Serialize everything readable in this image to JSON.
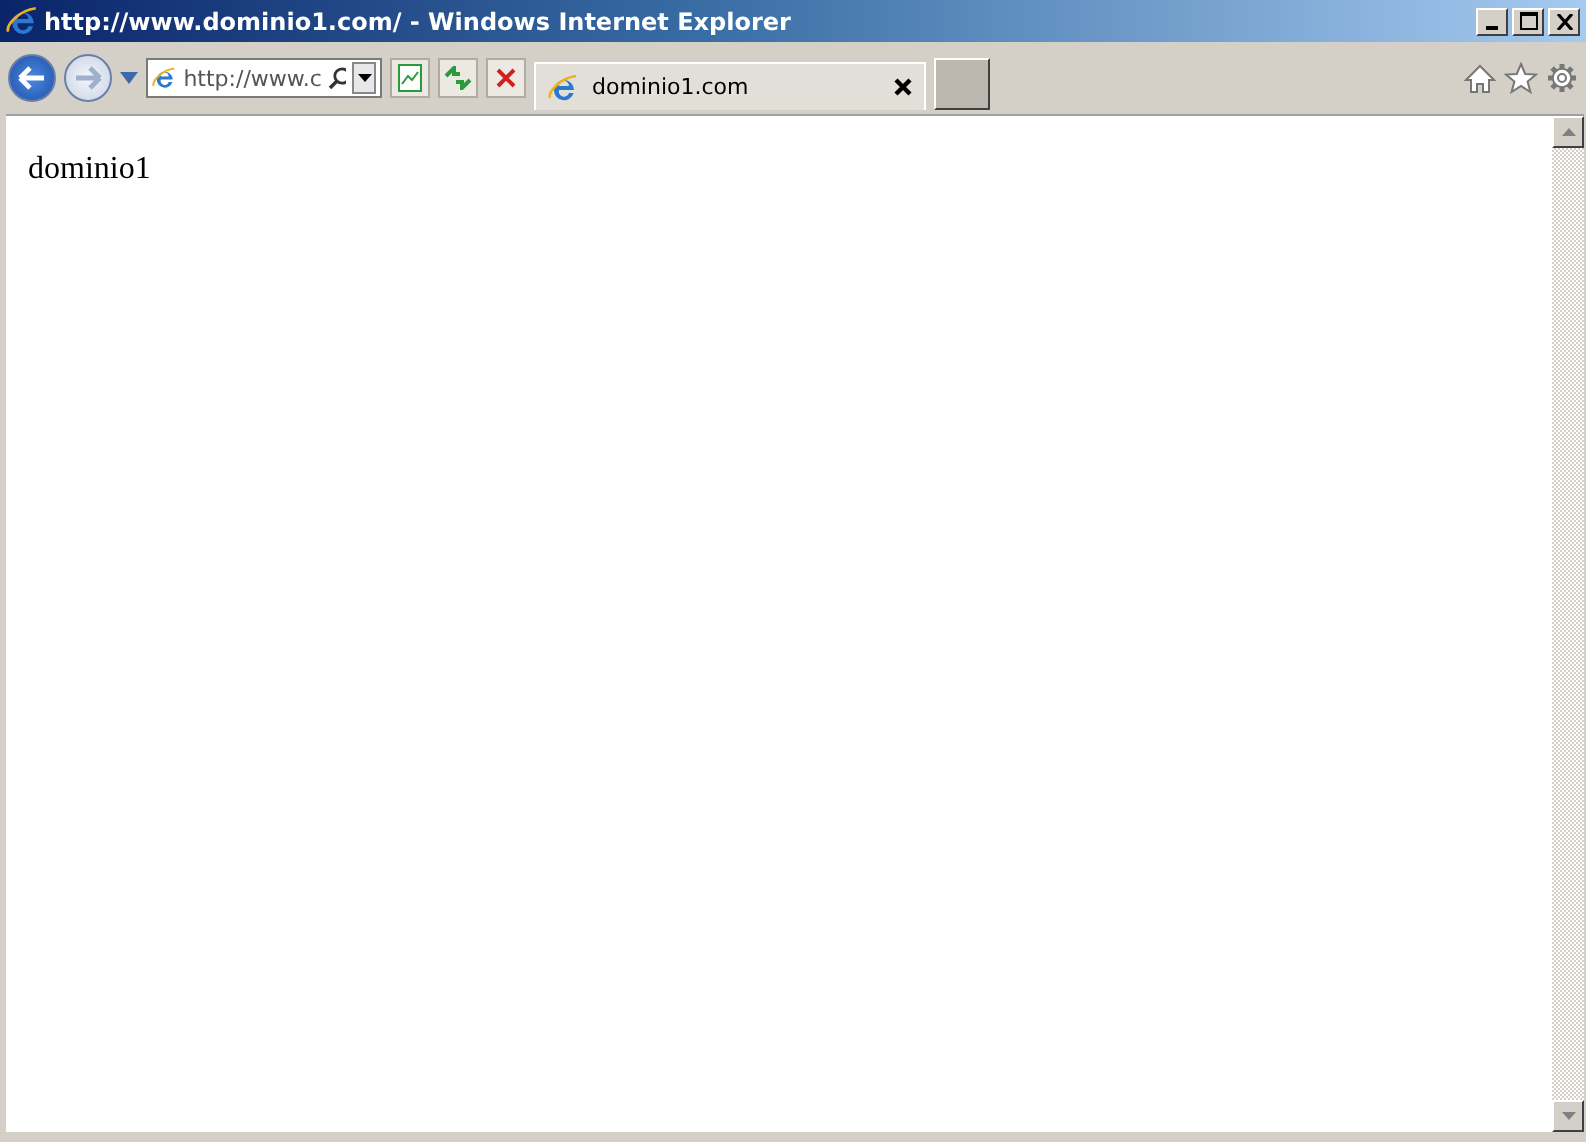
{
  "window": {
    "title": "http://www.dominio1.com/ - Windows Internet Explorer"
  },
  "address_bar": {
    "value": "http://www.c"
  },
  "tabs": [
    {
      "label": "dominio1.com",
      "selected": true
    }
  ],
  "page": {
    "text": "dominio1"
  }
}
